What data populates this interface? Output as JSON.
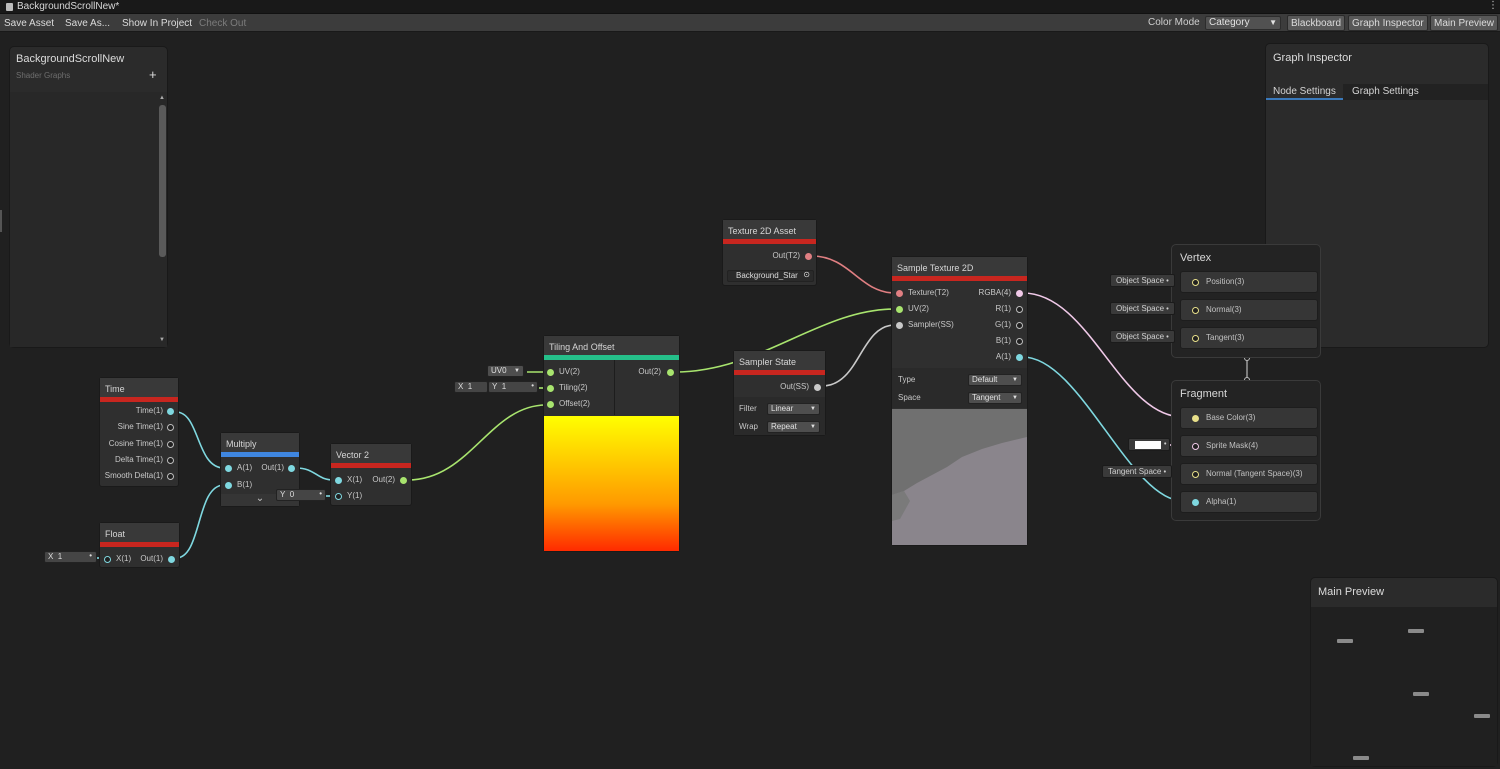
{
  "window": {
    "title": "BackgroundScrollNew*"
  },
  "toolbar": {
    "save_asset": "Save Asset",
    "save_as": "Save As...",
    "show_in_project": "Show In Project",
    "check_out": "Check Out",
    "color_mode_label": "Color Mode",
    "color_mode_value": "Category",
    "blackboard": "Blackboard",
    "graph_inspector": "Graph Inspector",
    "main_preview": "Main Preview"
  },
  "blackboard": {
    "title": "BackgroundScrollNew",
    "subtitle": "Shader Graphs",
    "add": "+"
  },
  "inspector": {
    "title": "Graph Inspector",
    "tabs": [
      "Node Settings",
      "Graph Settings"
    ]
  },
  "main_preview": {
    "title": "Main Preview"
  },
  "nodes": {
    "time": {
      "title": "Time",
      "outputs": [
        "Time(1)",
        "Sine Time(1)",
        "Cosine Time(1)",
        "Delta Time(1)",
        "Smooth Delta(1)"
      ]
    },
    "float": {
      "title": "Float",
      "input": "X(1)",
      "output": "Out(1)",
      "x_label": "X",
      "x_value": "1"
    },
    "multiply": {
      "title": "Multiply",
      "inputs": [
        "A(1)",
        "B(1)"
      ],
      "output": "Out(1)",
      "expand": "⌄"
    },
    "vector2": {
      "title": "Vector 2",
      "inputs": [
        "X(1)",
        "Y(1)"
      ],
      "output": "Out(2)",
      "y_label": "Y",
      "y_value": "0"
    },
    "tiling": {
      "title": "Tiling And Offset",
      "inputs": [
        "UV(2)",
        "Tiling(2)",
        "Offset(2)"
      ],
      "output": "Out(2)",
      "uv_value": "UV0",
      "tx_label": "X",
      "tx_value": "1",
      "ty_label": "Y",
      "ty_value": "1"
    },
    "texasset": {
      "title": "Texture 2D Asset",
      "output": "Out(T2)",
      "asset": "Background_Star"
    },
    "sampler": {
      "title": "Sampler State",
      "output": "Out(SS)",
      "filter_label": "Filter",
      "filter_value": "Linear",
      "wrap_label": "Wrap",
      "wrap_value": "Repeat"
    },
    "sample": {
      "title": "Sample Texture 2D",
      "inputs": [
        "Texture(T2)",
        "UV(2)",
        "Sampler(SS)"
      ],
      "outputs": [
        "RGBA(4)",
        "R(1)",
        "G(1)",
        "B(1)",
        "A(1)"
      ],
      "type_label": "Type",
      "type_value": "Default",
      "space_label": "Space",
      "space_value": "Tangent"
    }
  },
  "vertex": {
    "title": "Vertex",
    "slots": [
      "Position(3)",
      "Normal(3)",
      "Tangent(3)"
    ],
    "chips": [
      "Object Space",
      "Object Space",
      "Object Space"
    ]
  },
  "fragment": {
    "title": "Fragment",
    "slots": [
      "Base Color(3)",
      "Sprite Mask(4)",
      "Normal (Tangent Space)(3)",
      "Alpha(1)"
    ],
    "chip": "Tangent Space"
  },
  "colors": {
    "float_wire": "#7fd8e0",
    "vec2_wire": "#a8e46e",
    "texture_wire": "#e07f82",
    "vec4_wire": "#f0c9e8",
    "ss_wire": "#c9c9c9"
  }
}
